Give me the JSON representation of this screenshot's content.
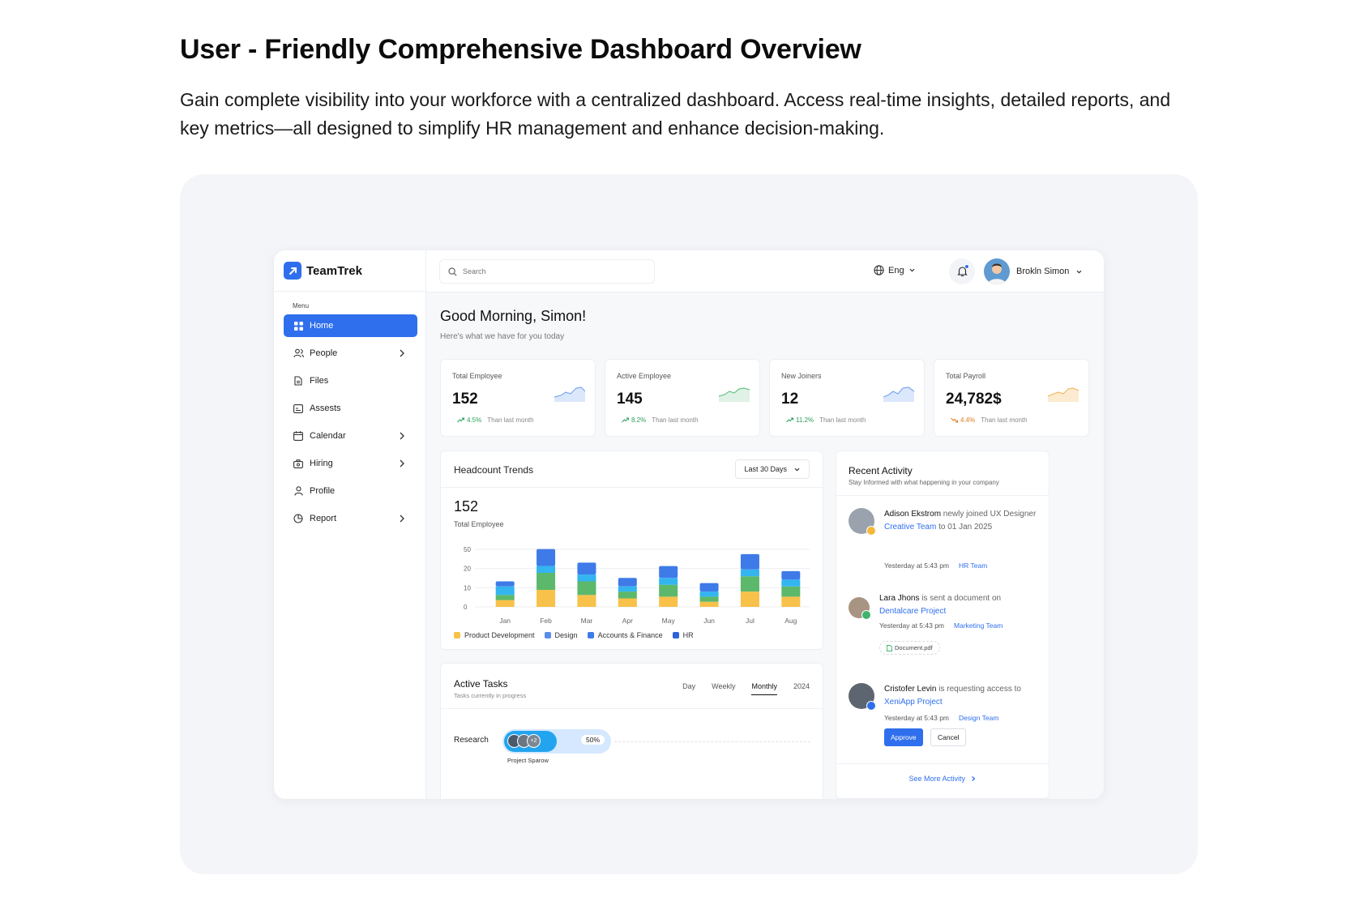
{
  "hero": {
    "title": "User - Friendly Comprehensive Dashboard Overview",
    "description": "Gain complete visibility into your workforce with a centralized dashboard. Access real-time insights, detailed reports, and key metrics—all designed to simplify HR management and enhance decision-making."
  },
  "app": {
    "brand": "TeamTrek",
    "menu_label": "Menu",
    "nav": [
      {
        "label": "Home",
        "icon": "grid-icon",
        "active": true,
        "chevron": false
      },
      {
        "label": "People",
        "icon": "people-icon",
        "active": false,
        "chevron": true
      },
      {
        "label": "Files",
        "icon": "file-icon",
        "active": false,
        "chevron": false
      },
      {
        "label": "Assests",
        "icon": "asset-icon",
        "active": false,
        "chevron": false
      },
      {
        "label": "Calendar",
        "icon": "calendar-icon",
        "active": false,
        "chevron": true
      },
      {
        "label": "Hiring",
        "icon": "briefcase-icon",
        "active": false,
        "chevron": true
      },
      {
        "label": "Profile",
        "icon": "user-icon",
        "active": false,
        "chevron": false
      },
      {
        "label": "Report",
        "icon": "report-icon",
        "active": false,
        "chevron": true
      }
    ],
    "search_placeholder": "Search",
    "language": "Eng",
    "user_name": "Brokln Simon",
    "greeting": "Good Morning, Simon!",
    "greeting_sub": "Here's what we have for you today",
    "accent": "#2f6fed"
  },
  "stats": [
    {
      "label": "Total Employee",
      "value": "152",
      "delta": "4.5%",
      "trend": "up",
      "note": "Than last month"
    },
    {
      "label": "Active Employee",
      "value": "145",
      "delta": "8.2%",
      "trend": "up",
      "note": "Than last month"
    },
    {
      "label": "New Joiners",
      "value": "12",
      "delta": "11.2%",
      "trend": "up",
      "note": "Than last month"
    },
    {
      "label": "Total Payroll",
      "value": "24,782$",
      "delta": "4.4%",
      "trend": "down",
      "note": "Than last month"
    }
  ],
  "headcount": {
    "title": "Headcount Trends",
    "range": "Last 30 Days",
    "value": "152",
    "sub": "Total Employee"
  },
  "chart_data": {
    "type": "bar",
    "stacked": true,
    "categories": [
      "Jan",
      "Feb",
      "Mar",
      "Apr",
      "May",
      "Jun",
      "Jul",
      "Aug"
    ],
    "y_ticks": [
      "0",
      "10",
      "20",
      "50"
    ],
    "series": [
      {
        "name": "Product Development",
        "color": "#f8c14a",
        "values": [
          4,
          10,
          7,
          5,
          6,
          3,
          9,
          6
        ]
      },
      {
        "name": "Design",
        "color": "#5cb86b",
        "values": [
          3,
          10,
          8,
          4,
          7,
          3,
          9,
          6
        ]
      },
      {
        "name": "Accounts & Finance",
        "color": "#33b5f0",
        "values": [
          5,
          4,
          4,
          3,
          4,
          3,
          4,
          4
        ]
      },
      {
        "name": "HR",
        "color": "#3e7be8",
        "values": [
          3,
          10,
          7,
          5,
          7,
          5,
          9,
          5
        ]
      }
    ],
    "legend": [
      {
        "name": "Product Development",
        "color": "#f8c14a"
      },
      {
        "name": "Design",
        "color": "#5b8de8"
      },
      {
        "name": "Accounts & Finance",
        "color": "#3e7be8"
      },
      {
        "name": "HR",
        "color": "#2f62d8"
      }
    ]
  },
  "tasks": {
    "title": "Active Tasks",
    "sub": "Tasks currently in progress",
    "tabs": [
      "Day",
      "Weekly",
      "Monthly",
      "2024"
    ],
    "active_tab": "Monthly",
    "row_label": "Research",
    "progress": 0.5,
    "progress_text": "50%",
    "extra_members": "+2",
    "project": "Project Sparow"
  },
  "activity": {
    "title": "Recent Activity",
    "sub": "Stay Informed with what happening in your company",
    "items": [
      {
        "name": "Adison Ekstrom",
        "text1": " newly joined UX Designer ",
        "link": "Creative Team",
        "text2": " to 01 Jan 2025",
        "time": "Yesterday at 5:43 pm",
        "team": "HR Team"
      },
      {
        "name": "Lara Jhons",
        "text1": " is sent a document on ",
        "link": "Dentalcare Project",
        "text2": "",
        "time": "Yesterday at 5:43 pm",
        "team": "Marketing Team",
        "doc": "Document.pdf"
      },
      {
        "name": "Cristofer Levin",
        "text1": " is requesting access to ",
        "link": "XeniApp Project",
        "text2": "",
        "time": "Yesterday at 5:43 pm",
        "team": "Design Team",
        "approve": "Approve",
        "cancel": "Cancel"
      }
    ],
    "see_more": "See More Activity"
  }
}
